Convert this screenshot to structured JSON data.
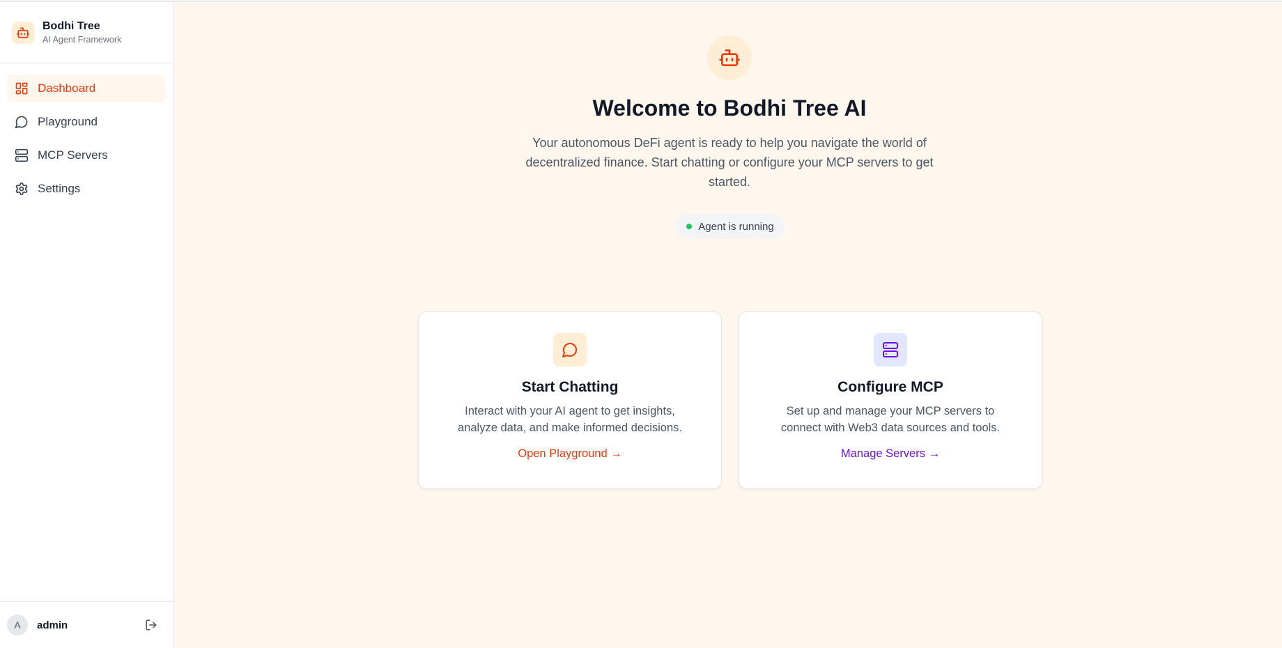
{
  "brand": {
    "name": "Bodhi Tree",
    "subtitle": "AI Agent Framework"
  },
  "nav": {
    "items": [
      {
        "label": "Dashboard",
        "icon": "dashboard-icon",
        "active": true
      },
      {
        "label": "Playground",
        "icon": "chat-bubble-icon",
        "active": false
      },
      {
        "label": "MCP Servers",
        "icon": "server-icon",
        "active": false
      },
      {
        "label": "Settings",
        "icon": "gear-icon",
        "active": false
      }
    ]
  },
  "user": {
    "initial": "A",
    "name": "admin"
  },
  "hero": {
    "title": "Welcome to Bodhi Tree AI",
    "description": "Your autonomous DeFi agent is ready to help you navigate the world of decentralized finance. Start chatting or configure your MCP servers to get started.",
    "status": "Agent is running"
  },
  "cards": [
    {
      "title": "Start Chatting",
      "description": "Interact with your AI agent to get insights, analyze data, and make informed decisions.",
      "link": "Open Playground →",
      "icon": "chat-bubble-icon"
    },
    {
      "title": "Configure MCP",
      "description": "Set up and manage your MCP servers to connect with Web3 data sources and tools.",
      "link": "Manage Servers →",
      "icon": "server-icon"
    }
  ],
  "colors": {
    "accent": "#ea3a0c",
    "accent_soft": "#ffedd5",
    "main_background": "#fff7ed",
    "status_green": "#22c55e",
    "mcp_purple": "#6d12e0",
    "mcp_soft": "#e0e7ff"
  }
}
